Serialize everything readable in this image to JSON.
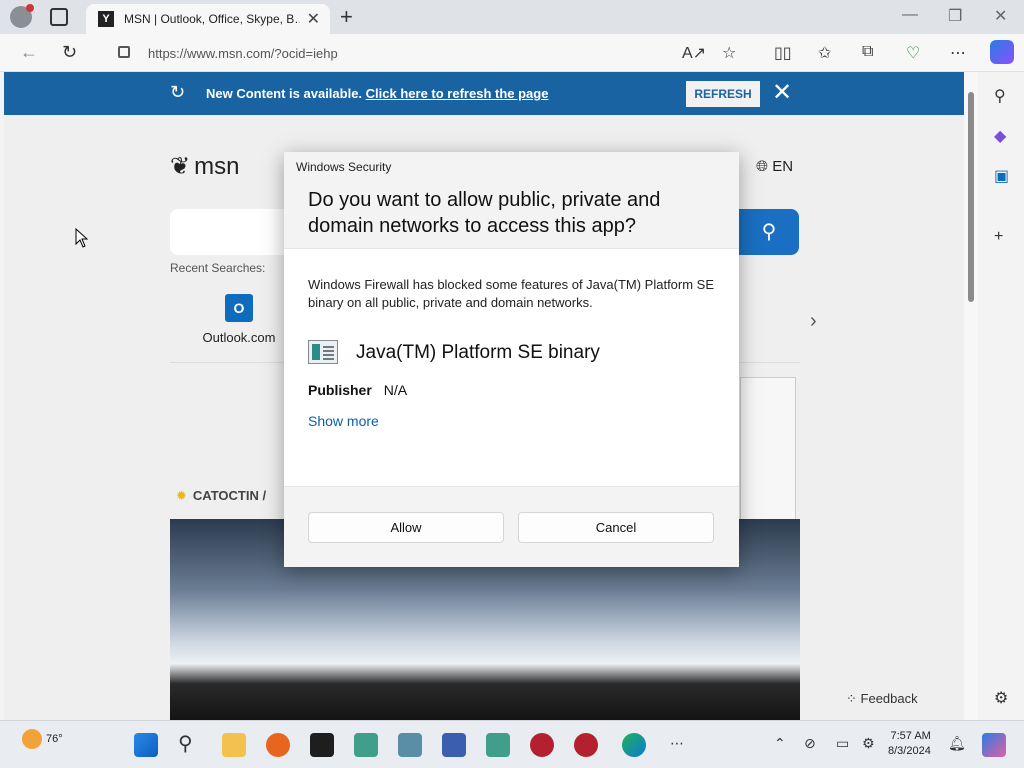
{
  "browser": {
    "tab_title": "MSN | Outlook, Office, Skype, B…",
    "url": "https://www.msn.com/?ocid=iehp"
  },
  "banner": {
    "text": "New Content is available.",
    "link": "Click here to refresh the page",
    "refresh_label": "REFRESH"
  },
  "msn": {
    "logo": "msn",
    "language": "EN",
    "recent_label": "Recent Searches:",
    "tile_outlook": "Outlook.com",
    "weather_location": "CATOCTIN /",
    "feedback": "Feedback"
  },
  "dialog": {
    "caption": "Windows Security",
    "question": "Do you want to allow public, private and domain networks to access this app?",
    "body": "Windows Firewall has blocked some features of Java(TM) Platform SE binary on all public, private and domain networks.",
    "app_name": "Java(TM) Platform SE binary",
    "publisher_label": "Publisher",
    "publisher_value": "N/A",
    "show_more": "Show more",
    "allow": "Allow",
    "cancel": "Cancel"
  },
  "taskbar": {
    "temperature": "76°",
    "time": "7:57 AM",
    "date": "8/3/2024"
  },
  "colors": {
    "banner": "#1a63a3",
    "search_button": "#1a6fc2",
    "link": "#0a5fa8"
  }
}
